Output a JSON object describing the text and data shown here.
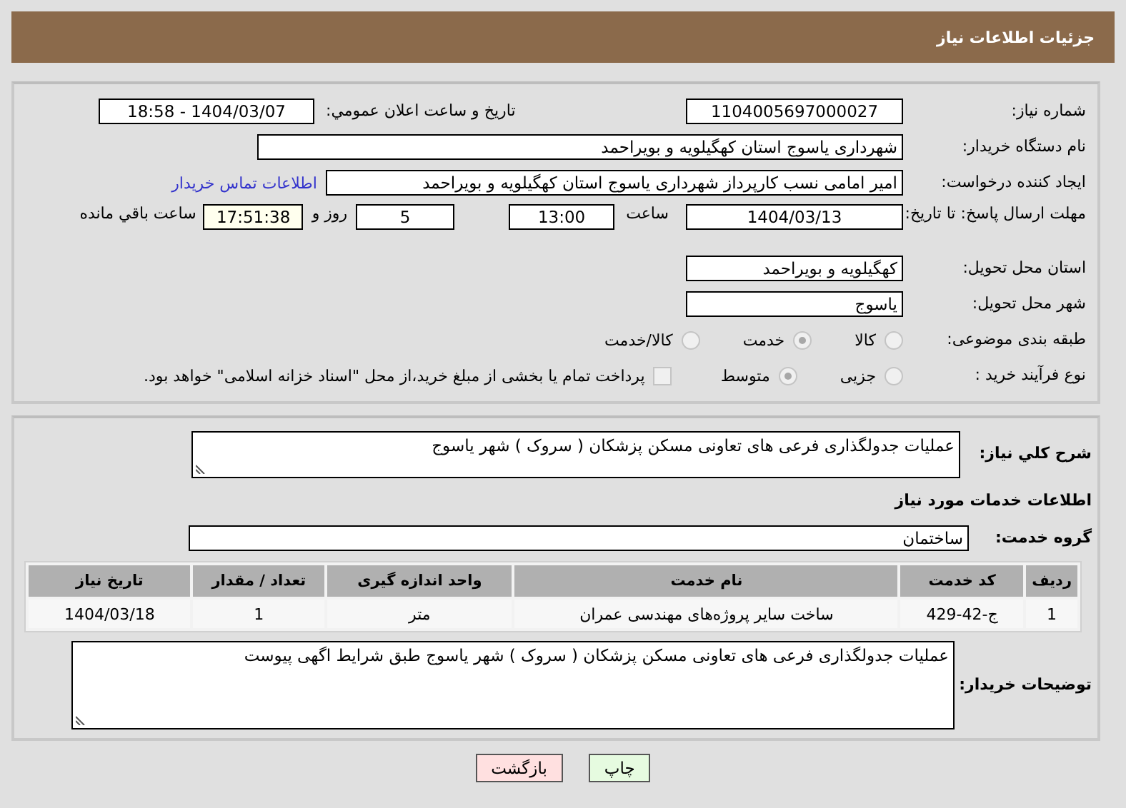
{
  "header": {
    "title": "جزئیات اطلاعات نیاز"
  },
  "details": {
    "need_number": {
      "label": "شماره نیاز:",
      "value": "1104005697000027"
    },
    "announce": {
      "label": "تاریخ و ساعت اعلان عمومي:",
      "value": "1404/03/07 - 18:58"
    },
    "buyer": {
      "label": "نام دستگاه خریدار:",
      "value": "شهرداری یاسوج استان کهگیلویه و بویراحمد"
    },
    "creator": {
      "label": "ایجاد کننده درخواست:",
      "value": "امیر امامی نسب کارپرداز شهرداری یاسوج استان کهگیلویه و بویراحمد",
      "link": "اطلاعات تماس خریدار"
    },
    "deadline": {
      "label": "مهلت ارسال پاسخ: تا تاریخ:",
      "date": "1404/03/13",
      "time_label": "ساعت",
      "time": "13:00",
      "days": "5",
      "days_label": "روز و",
      "remaining": "17:51:38",
      "remaining_label": "ساعت باقي مانده"
    },
    "province": {
      "label": "استان محل تحویل:",
      "value": "کهگیلویه و بویراحمد"
    },
    "city": {
      "label": "شهر محل تحویل:",
      "value": "یاسوج"
    },
    "category": {
      "label": "طبقه بندی موضوعی:",
      "options": [
        {
          "label": "کالا",
          "selected": false
        },
        {
          "label": "خدمت",
          "selected": true
        },
        {
          "label": "کالا/خدمت",
          "selected": false
        }
      ]
    },
    "process": {
      "label": "نوع فرآیند خرید :",
      "options": [
        {
          "label": "جزیی",
          "selected": false
        },
        {
          "label": "متوسط",
          "selected": true
        }
      ],
      "payment": {
        "checked": false,
        "text": "پرداخت تمام یا بخشی از مبلغ خرید،از محل \"اسناد خزانه اسلامی\" خواهد بود."
      }
    }
  },
  "description": {
    "label": "شرح کلي نیاز:",
    "value": "عملیات جدولگذاری فرعی های تعاونی مسکن پزشکان ( سروک ) شهر یاسوج"
  },
  "services": {
    "title": "اطلاعات خدمات مورد نیاز",
    "group_label": "گروه خدمت:",
    "group": "ساختمان",
    "table": {
      "columns": [
        "ردیف",
        "کد خدمت",
        "نام خدمت",
        "واحد اندازه گیری",
        "تعداد / مقدار",
        "تاریخ نیاز"
      ],
      "rows": [
        [
          "1",
          "ج-42-429",
          "ساخت سایر پروژه‌های مهندسی عمران",
          "متر",
          "1",
          "1404/03/18"
        ]
      ]
    }
  },
  "buyer_notes": {
    "label": "توضیحات خریدار:",
    "value": "عملیات جدولگذاری فرعی های تعاونی مسکن پزشکان ( سروک ) شهر یاسوج طبق شرایط اگهی پیوست"
  },
  "buttons": [
    {
      "label": "چاپ",
      "kind": "print"
    },
    {
      "label": "بازگشت",
      "kind": "back"
    }
  ]
}
